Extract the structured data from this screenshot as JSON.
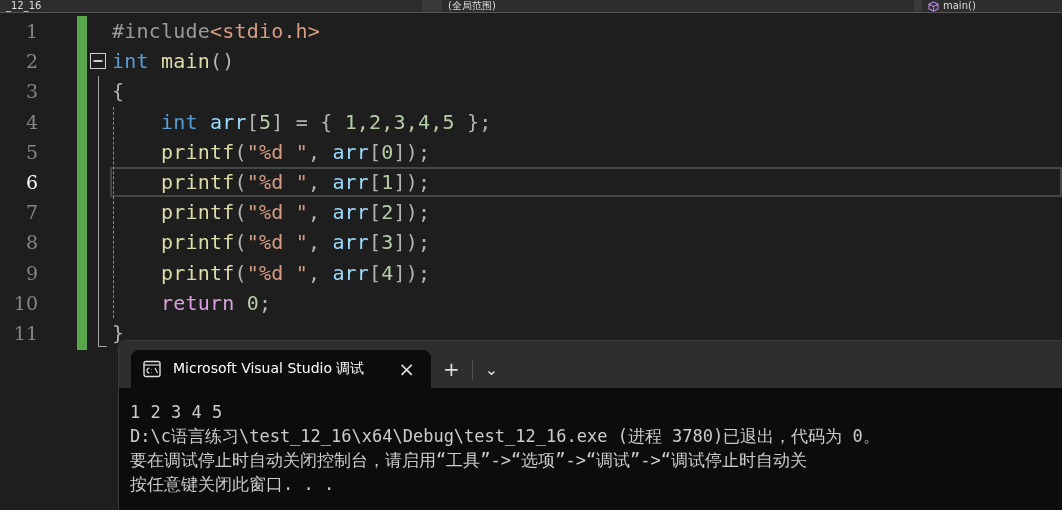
{
  "navigation_bar": {
    "project": "_12_16",
    "scope": "(全局范围)",
    "member": "main()"
  },
  "editor": {
    "lines": [
      {
        "number": "1",
        "selected": false,
        "tokens": [
          {
            "text": "#include",
            "kind": "preproc"
          },
          {
            "text": "<stdio.h>",
            "kind": "string"
          }
        ]
      },
      {
        "number": "2",
        "selected": false,
        "tokens": [
          {
            "text": "int ",
            "kind": "keyword"
          },
          {
            "text": "main",
            "kind": "function"
          },
          {
            "text": "()",
            "kind": "punct"
          }
        ]
      },
      {
        "number": "3",
        "selected": false,
        "tokens": [
          {
            "text": "{",
            "kind": "punct"
          }
        ]
      },
      {
        "number": "4",
        "selected": false,
        "tokens": [
          {
            "text": "    int ",
            "kind": "keyword"
          },
          {
            "text": "arr",
            "kind": "variable"
          },
          {
            "text": "[",
            "kind": "punct"
          },
          {
            "text": "5",
            "kind": "number"
          },
          {
            "text": "] = { ",
            "kind": "punct"
          },
          {
            "text": "1,2,3,4,5",
            "kind": "number"
          },
          {
            "text": " };",
            "kind": "punct"
          }
        ]
      },
      {
        "number": "5",
        "selected": false,
        "tokens": [
          {
            "text": "    printf",
            "kind": "function"
          },
          {
            "text": "(",
            "kind": "punct"
          },
          {
            "text": "\"%d \"",
            "kind": "string"
          },
          {
            "text": ", ",
            "kind": "punct"
          },
          {
            "text": "arr",
            "kind": "variable"
          },
          {
            "text": "[",
            "kind": "punct"
          },
          {
            "text": "0",
            "kind": "number"
          },
          {
            "text": "]);",
            "kind": "punct"
          }
        ]
      },
      {
        "number": "6",
        "selected": true,
        "tokens": [
          {
            "text": "    printf",
            "kind": "function"
          },
          {
            "text": "(",
            "kind": "punct"
          },
          {
            "text": "\"%d \"",
            "kind": "string"
          },
          {
            "text": ", ",
            "kind": "punct"
          },
          {
            "text": "arr",
            "kind": "variable"
          },
          {
            "text": "[",
            "kind": "punct"
          },
          {
            "text": "1",
            "kind": "number"
          },
          {
            "text": "]);",
            "kind": "punct"
          }
        ]
      },
      {
        "number": "7",
        "selected": false,
        "tokens": [
          {
            "text": "    printf",
            "kind": "function"
          },
          {
            "text": "(",
            "kind": "punct"
          },
          {
            "text": "\"%d \"",
            "kind": "string"
          },
          {
            "text": ", ",
            "kind": "punct"
          },
          {
            "text": "arr",
            "kind": "variable"
          },
          {
            "text": "[",
            "kind": "punct"
          },
          {
            "text": "2",
            "kind": "number"
          },
          {
            "text": "]);",
            "kind": "punct"
          }
        ]
      },
      {
        "number": "8",
        "selected": false,
        "tokens": [
          {
            "text": "    printf",
            "kind": "function"
          },
          {
            "text": "(",
            "kind": "punct"
          },
          {
            "text": "\"%d \"",
            "kind": "string"
          },
          {
            "text": ", ",
            "kind": "punct"
          },
          {
            "text": "arr",
            "kind": "variable"
          },
          {
            "text": "[",
            "kind": "punct"
          },
          {
            "text": "3",
            "kind": "number"
          },
          {
            "text": "]);",
            "kind": "punct"
          }
        ]
      },
      {
        "number": "9",
        "selected": false,
        "tokens": [
          {
            "text": "    printf",
            "kind": "function"
          },
          {
            "text": "(",
            "kind": "punct"
          },
          {
            "text": "\"%d \"",
            "kind": "string"
          },
          {
            "text": ", ",
            "kind": "punct"
          },
          {
            "text": "arr",
            "kind": "variable"
          },
          {
            "text": "[",
            "kind": "punct"
          },
          {
            "text": "4",
            "kind": "number"
          },
          {
            "text": "]);",
            "kind": "punct"
          }
        ]
      },
      {
        "number": "10",
        "selected": false,
        "tokens": [
          {
            "text": "    return ",
            "kind": "control"
          },
          {
            "text": "0",
            "kind": "number"
          },
          {
            "text": ";",
            "kind": "punct"
          }
        ]
      },
      {
        "number": "11",
        "selected": false,
        "tokens": [
          {
            "text": "}",
            "kind": "punct"
          }
        ]
      }
    ]
  },
  "terminal": {
    "tab": {
      "title": "Microsoft Visual Studio 调试",
      "close": "×"
    },
    "new_tab": "+",
    "dropdown": "⌄",
    "output": [
      "1 2 3 4 5",
      "D:\\c语言练习\\test_12_16\\x64\\Debug\\test_12_16.exe (进程 3780)已退出，代码为 0。",
      "要在调试停止时自动关闭控制台，请启用“工具”->“选项”->“调试”->“调试停止时自动关",
      "按任意键关闭此窗口. . ."
    ]
  }
}
